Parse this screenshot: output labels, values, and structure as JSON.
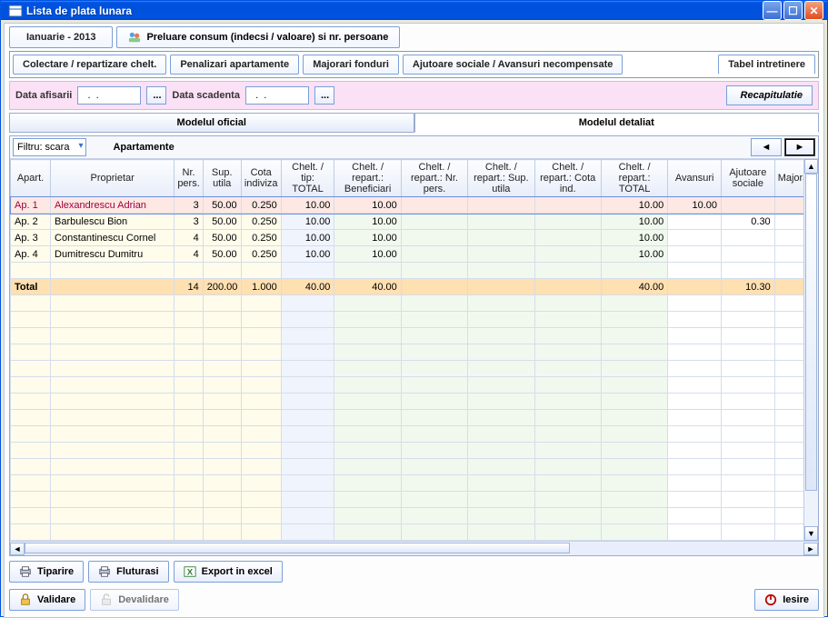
{
  "window": {
    "title": "Lista de plata lunara"
  },
  "header": {
    "month": "Ianuarie - 2013",
    "preluare": "Preluare consum (indecsi / valoare) si nr. persoane"
  },
  "tabs": {
    "colectare": "Colectare / repartizare chelt.",
    "penalizari": "Penalizari apartamente",
    "majorari": "Majorari fonduri",
    "ajutoare": "Ajutoare sociale / Avansuri necompensate",
    "tabel": "Tabel intretinere"
  },
  "datebar": {
    "afisarii_label": "Data afisarii",
    "afisarii_value": "  .  .",
    "scadenta_label": "Data scadenta",
    "scadenta_value": "  .  .",
    "recap": "Recapitulatie"
  },
  "model_tabs": {
    "oficial": "Modelul oficial",
    "detaliat": "Modelul detaliat"
  },
  "grid_toolbar": {
    "filtru": "Filtru: scara",
    "apart": "Apartamente",
    "prev": "◄",
    "next": "►"
  },
  "columns": {
    "apart": "Apart.",
    "prop": "Proprietar",
    "np": "Nr. pers.",
    "su": "Sup. utila",
    "ci": "Cota indiviza",
    "ct": "Chelt. / tip: TOTAL",
    "cb": "Chelt. / repart.: Beneficiari",
    "cn": "Chelt. / repart.: Nr. pers.",
    "cs": "Chelt. / repart.: Sup. utila",
    "cc": "Chelt. / repart.: Cota ind.",
    "crt": "Chelt. / repart.: TOTAL",
    "av": "Avansuri",
    "as": "Ajutoare sociale",
    "mj": "Majorari:"
  },
  "rows": [
    {
      "apart": "Ap. 1",
      "prop": "Alexandrescu Adrian",
      "np": "3",
      "su": "50.00",
      "ci": "0.250",
      "ct": "10.00",
      "cb": "10.00",
      "crt": "10.00",
      "av": "10.00",
      "hl": true
    },
    {
      "apart": "Ap. 2",
      "prop": "Barbulescu Bion",
      "np": "3",
      "su": "50.00",
      "ci": "0.250",
      "ct": "10.00",
      "cb": "10.00",
      "crt": "10.00",
      "as": "0.30"
    },
    {
      "apart": "Ap. 3",
      "prop": "Constantinescu Cornel",
      "np": "4",
      "su": "50.00",
      "ci": "0.250",
      "ct": "10.00",
      "cb": "10.00",
      "crt": "10.00"
    },
    {
      "apart": "Ap. 4",
      "prop": "Dumitrescu Dumitru",
      "np": "4",
      "su": "50.00",
      "ci": "0.250",
      "ct": "10.00",
      "cb": "10.00",
      "crt": "10.00"
    }
  ],
  "total": {
    "label": "Total",
    "np": "14",
    "su": "200.00",
    "ci": "1.000",
    "ct": "40.00",
    "cb": "40.00",
    "crt": "40.00",
    "as": "10.30"
  },
  "buttons": {
    "tiparire": "Tiparire",
    "fluturasi": "Fluturasi",
    "export": "Export in excel",
    "validare": "Validare",
    "devalidare": "Devalidare",
    "iesire": "Iesire"
  }
}
